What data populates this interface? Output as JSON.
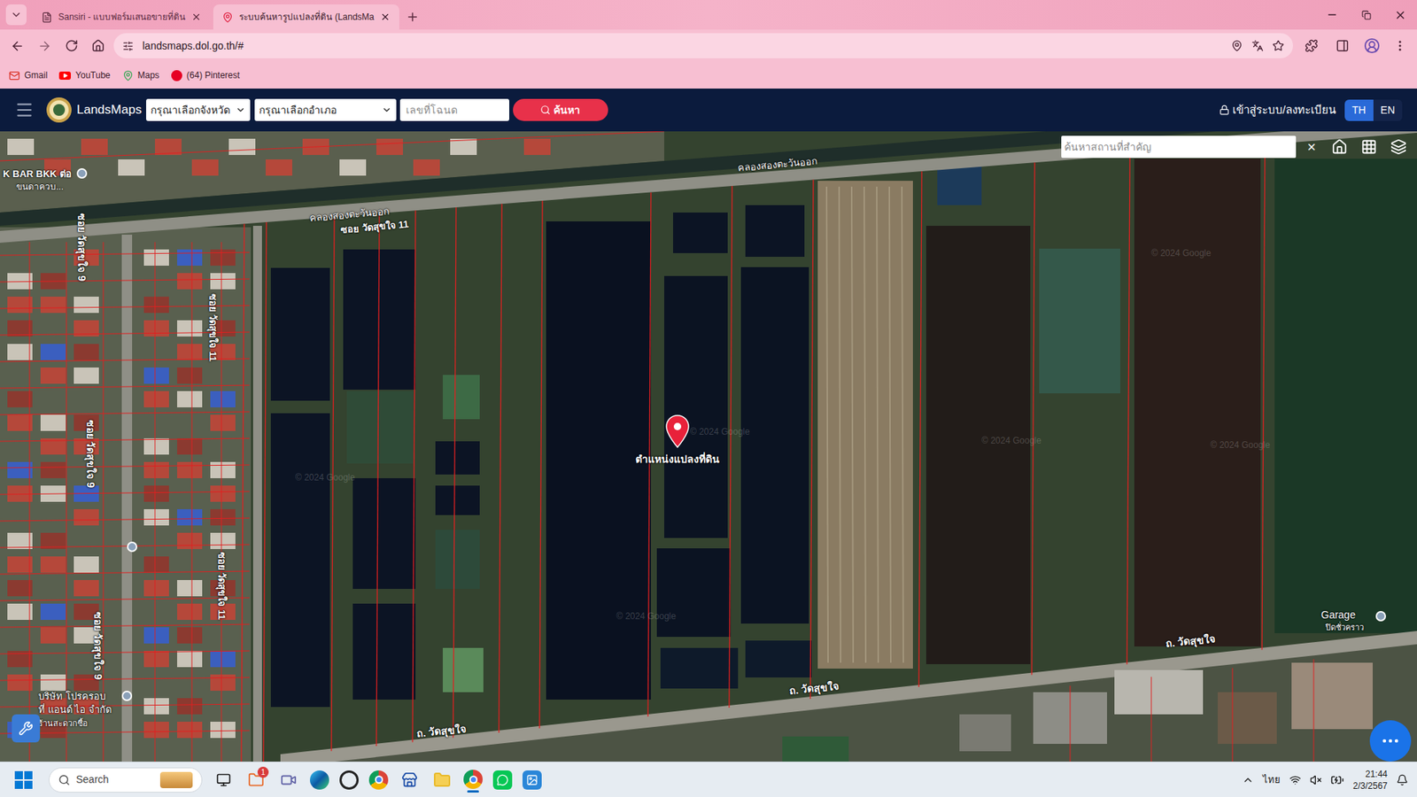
{
  "browser": {
    "tabs": [
      {
        "label": "Sansiri - แบบฟอร์มเสนอขายที่ดิน",
        "selected": false
      },
      {
        "label": "ระบบค้นหารูปแปลงที่ดิน (LandsMa",
        "selected": true
      }
    ],
    "url": "landsmaps.dol.go.th/#",
    "bookmarks": [
      {
        "label": "Gmail"
      },
      {
        "label": "YouTube"
      },
      {
        "label": "Maps"
      },
      {
        "label": "(64) Pinterest"
      }
    ]
  },
  "header": {
    "logo": "LandsMaps",
    "province_select": "กรุณาเลือกจังหวัด",
    "district_select": "กรุณาเลือกอำเภอ",
    "deed_placeholder": "เลขที่โฉนด",
    "search_button": "ค้นหา",
    "login": "เข้าสู่ระบบ/ลงทะเบียน",
    "languages": [
      {
        "label": "TH",
        "selected": true
      },
      {
        "label": "EN",
        "selected": false
      }
    ]
  },
  "map": {
    "search_placeholder": "ค้นหาสถานที่สำคัญ",
    "clear": "×",
    "pin_label": "ตำแหน่งแปลงที่ดิน",
    "watermark": "© 2024 Google",
    "labels": [
      "คลองสองตะวันออก",
      "คลองสองตะวันออก",
      "ซอย วัดสุขใจ 11",
      "ซอย วัดสุขใจ 9",
      "ซอย วัดสุขใจ 9",
      "ซอย วัดสุขใจ 9",
      "ซอย วัดสุขใจ 11",
      "ซอย วัดสุขใจ 11",
      "ถ. วัดสุขใจ",
      "ถ. วัดสุขใจ",
      "ถ. วัดสุขใจ",
      "Garage",
      "ปิดชั่วคราว",
      "K BAR BKK ต่อ",
      "ขนดาควบ...",
      "บริษัท โปรครอบ",
      "ที่ แอนด์ ไอ จำกัด",
      "ร้านสะดวกซื้อ"
    ]
  },
  "taskbar": {
    "search": "Search",
    "notification_badge": "1",
    "language": "ไทย",
    "time": "21:44",
    "date": "2/3/2567"
  }
}
